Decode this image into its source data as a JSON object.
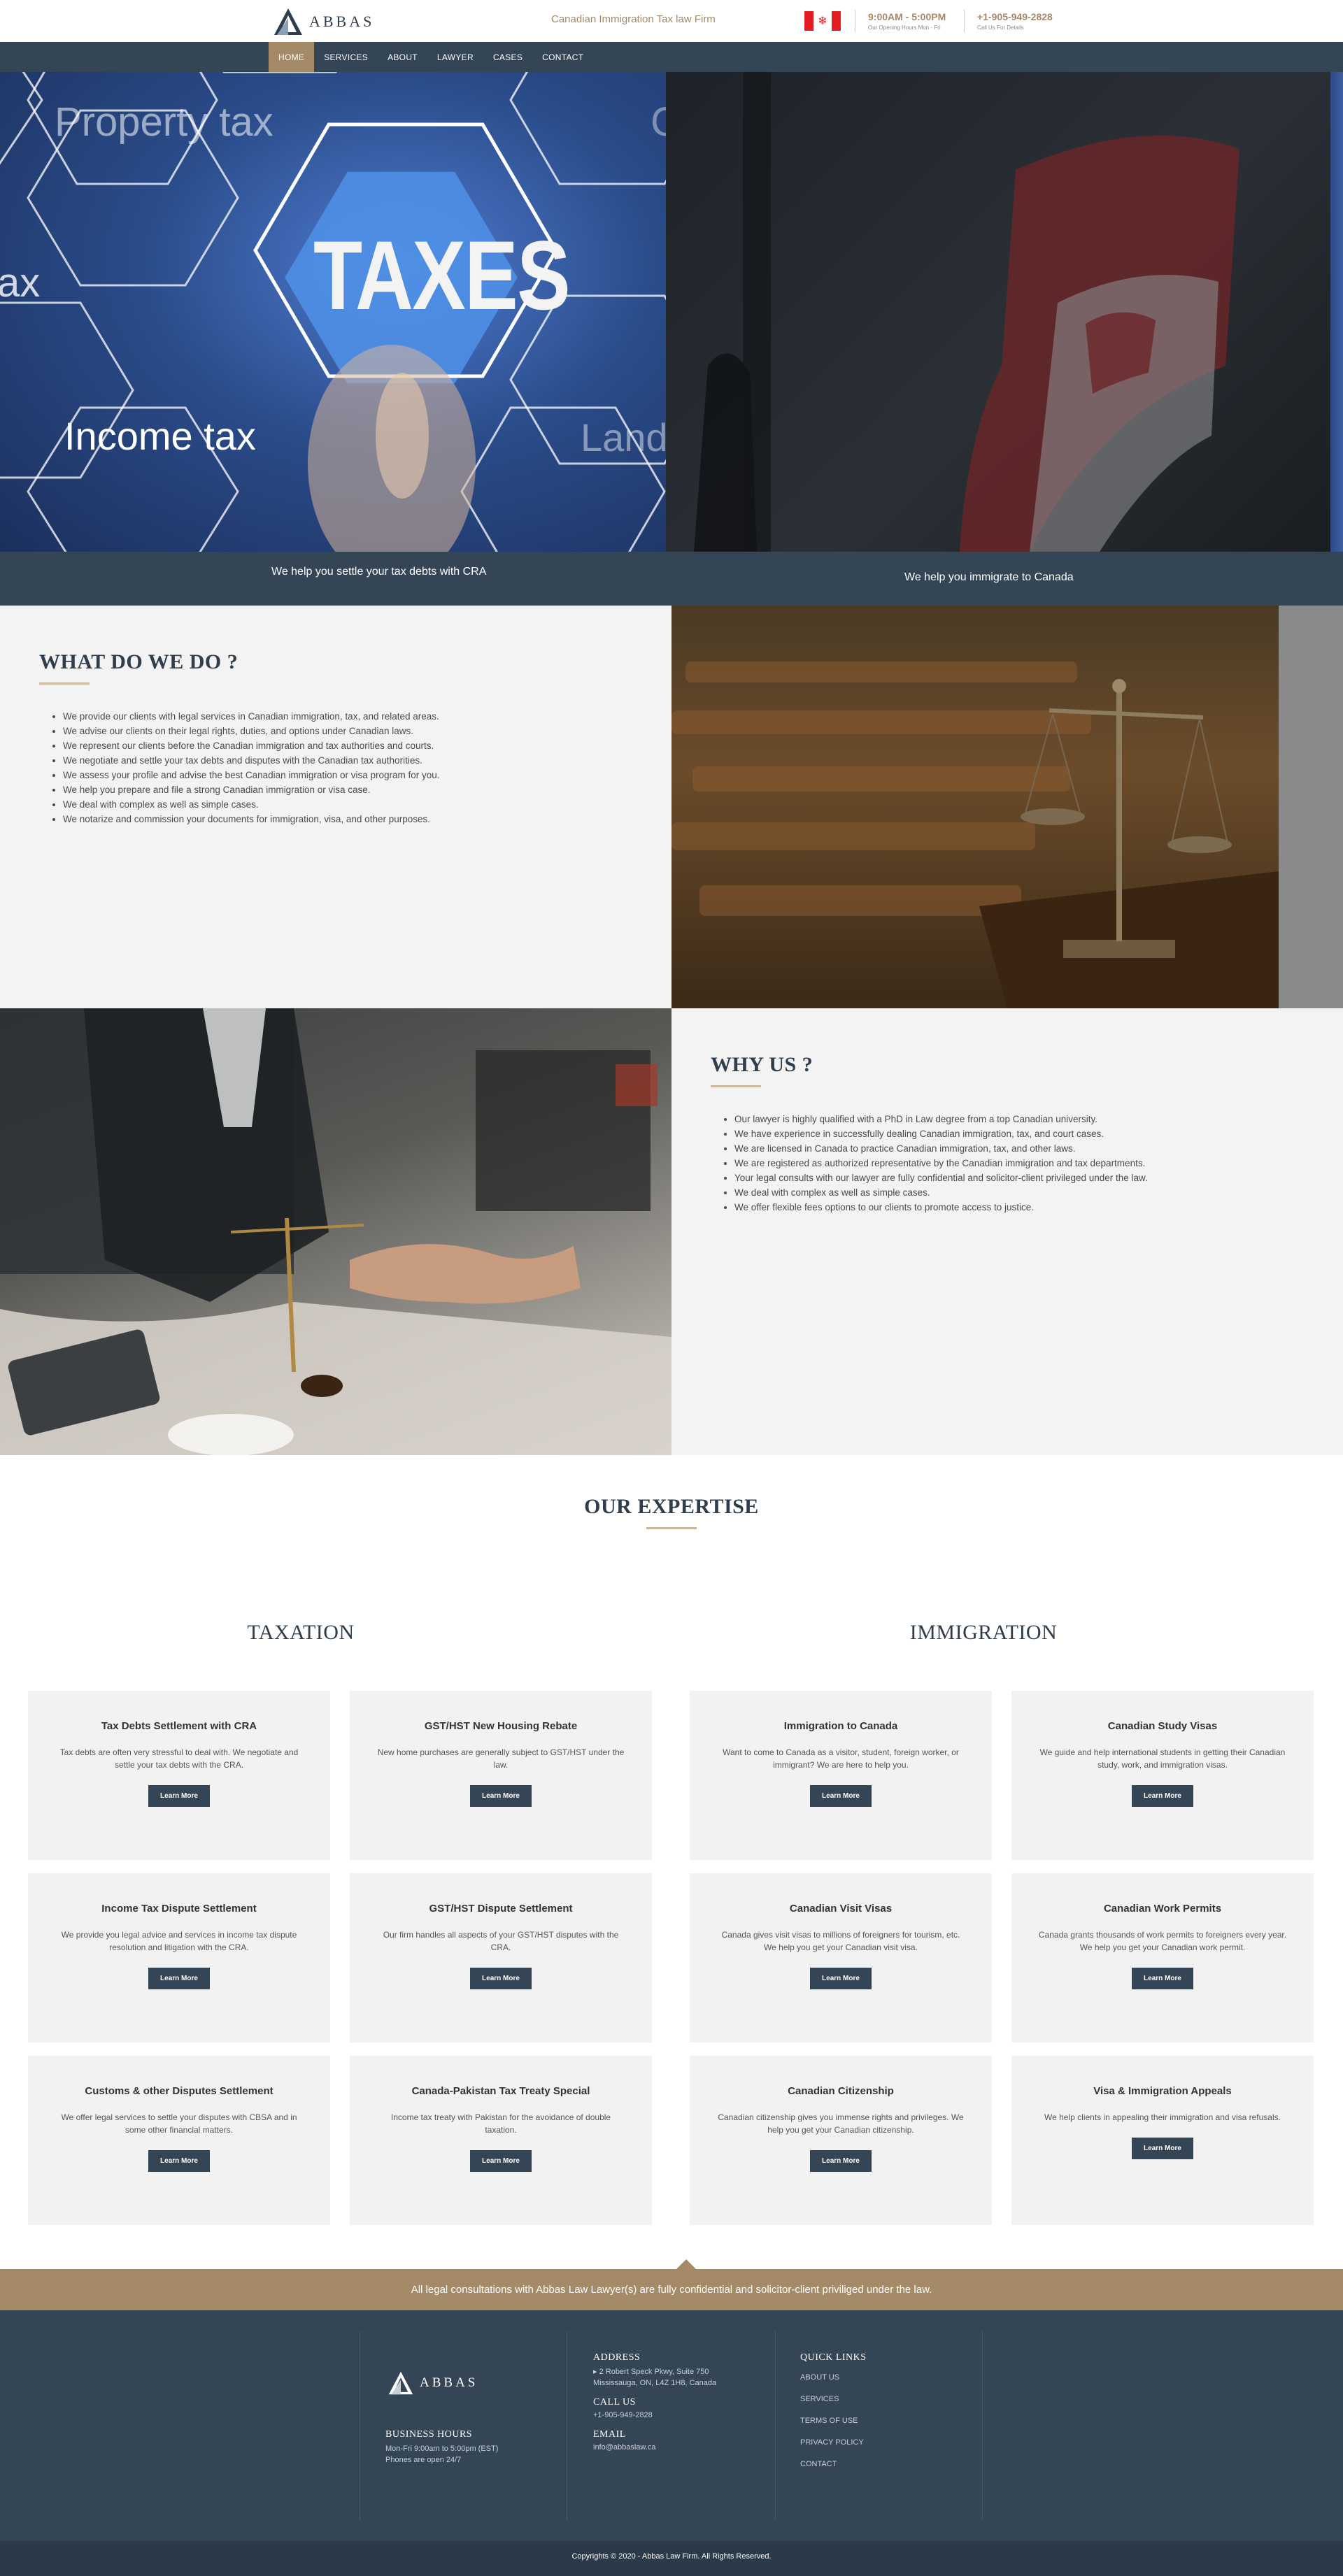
{
  "header": {
    "logo_text": "ABBAS",
    "tagline": "Canadian Immigration Tax law Firm",
    "hours_main": "9:00AM - 5:00PM",
    "hours_sub": "Our Opening Hours Mon - Fri",
    "phone_main": "+1-905-949-2828",
    "phone_sub": "Call Us For Details"
  },
  "nav": {
    "items": [
      "HOME",
      "SERVICES",
      "ABOUT",
      "LAWYER",
      "CASES",
      "CONTACT"
    ],
    "active": "HOME"
  },
  "hero": {
    "left_image": {
      "words": [
        "Property tax",
        "TAXES",
        "Income tax",
        "Land",
        "ax",
        "C"
      ]
    },
    "left_caption": "We help you settle your tax debts with CRA",
    "right_caption": "We help you immigrate to Canada"
  },
  "whatdo": {
    "title": "WHAT DO WE DO ?",
    "items": [
      "We provide our clients with legal services in Canadian immigration, tax, and related areas.",
      "We advise our clients on their legal rights, duties, and options under Canadian laws.",
      "We represent our clients before the Canadian immigration and tax authorities and courts.",
      "We negotiate and settle your tax debts and disputes with the Canadian tax authorities.",
      "We assess your profile and advise the best Canadian immigration or visa program for you.",
      "We help you prepare and file a strong Canadian immigration or visa case.",
      "We deal with complex as well as simple cases.",
      "We notarize and commission your documents for immigration, visa, and other purposes."
    ]
  },
  "whyus": {
    "title": "WHY US ?",
    "items": [
      "Our lawyer is highly qualified with a PhD in Law degree from a top Canadian university.",
      "We have experience in successfully dealing Canadian immigration, tax, and court cases.",
      "We are licensed in Canada to practice Canadian immigration, tax, and other laws.",
      "We are registered as authorized representative by the Canadian immigration and tax departments.",
      "Your legal consults with our lawyer are fully confidential and solicitor-client privileged under the law.",
      "We deal with complex as well as simple cases.",
      "We offer flexible fees options to our clients to promote access to justice."
    ]
  },
  "expertise": {
    "title": "OUR EXPERTISE",
    "button_label": "Learn More",
    "taxation": {
      "title": "TAXATION",
      "cards": [
        {
          "title": "Tax Debts Settlement with CRA",
          "text": "Tax debts are often very stressful to deal with. We negotiate and settle your tax debts with the CRA."
        },
        {
          "title": "GST/HST New Housing Rebate",
          "text": "New home purchases are generally subject to GST/HST under the law."
        },
        {
          "title": "Income Tax Dispute Settlement",
          "text": "We provide you legal advice and services in income tax dispute resolution and litigation with the CRA."
        },
        {
          "title": "GST/HST Dispute Settlement",
          "text": "Our firm handles all aspects of your GST/HST disputes with the CRA."
        },
        {
          "title": "Customs & other Disputes Settlement",
          "text": "We offer legal services to settle your disputes with CBSA and in some other financial matters."
        },
        {
          "title": "Canada-Pakistan Tax Treaty Special",
          "text": "Income tax treaty with Pakistan for the avoidance of double taxation."
        }
      ]
    },
    "immigration": {
      "title": "IMMIGRATION",
      "cards": [
        {
          "title": "Immigration to Canada",
          "text": "Want to come to Canada as a visitor, student, foreign worker, or immigrant? We are here to help you."
        },
        {
          "title": "Canadian Study Visas",
          "text": "We guide and help international students in getting their Canadian study, work, and immigration visas."
        },
        {
          "title": "Canadian Visit Visas",
          "text": "Canada gives visit visas to millions of foreigners for tourism, etc. We help you get your Canadian visit visa."
        },
        {
          "title": "Canadian Work Permits",
          "text": "Canada grants thousands of work permits to foreigners every year. We help you get your Canadian work permit."
        },
        {
          "title": "Canadian Citizenship",
          "text": "Canadian citizenship gives you immense rights and privileges. We help you get your Canadian citizenship."
        },
        {
          "title": "Visa & Immigration Appeals",
          "text": "We help clients in appealing their immigration and visa refusals."
        }
      ]
    }
  },
  "banner": {
    "text": "All legal consultations with Abbas Law Lawyer(s) are fully confidential and solicitor-client priviliged under the law."
  },
  "footer": {
    "logo_text": "ABBAS",
    "business_hours_title": "BUSINESS HOURS",
    "business_hours_line1": "Mon-Fri 9:00am to 5:00pm (EST)",
    "business_hours_line2": "Phones are open 24/7",
    "address_title": "ADDRESS",
    "address_line1": "2 Robert Speck Pkwy, Suite 750",
    "address_line2": "Mississauga, ON, L4Z 1H8, Canada",
    "call_title": "CALL US",
    "call_value": "+1-905-949-2828",
    "email_title": "EMAIL",
    "email_value": "info@abbaslaw.ca",
    "quick_links_title": "QUICK LINKS",
    "quick_links": [
      "ABOUT US",
      "SERVICES",
      "TERMS OF USE",
      "PRIVACY POLICY",
      "CONTACT"
    ],
    "copyright": "Copyrights © 2020 - Abbas Law Firm. All Rights Reserved."
  },
  "colors": {
    "navy": "#344556",
    "gold": "#a48a66",
    "light_gray": "#f3f3f3"
  }
}
